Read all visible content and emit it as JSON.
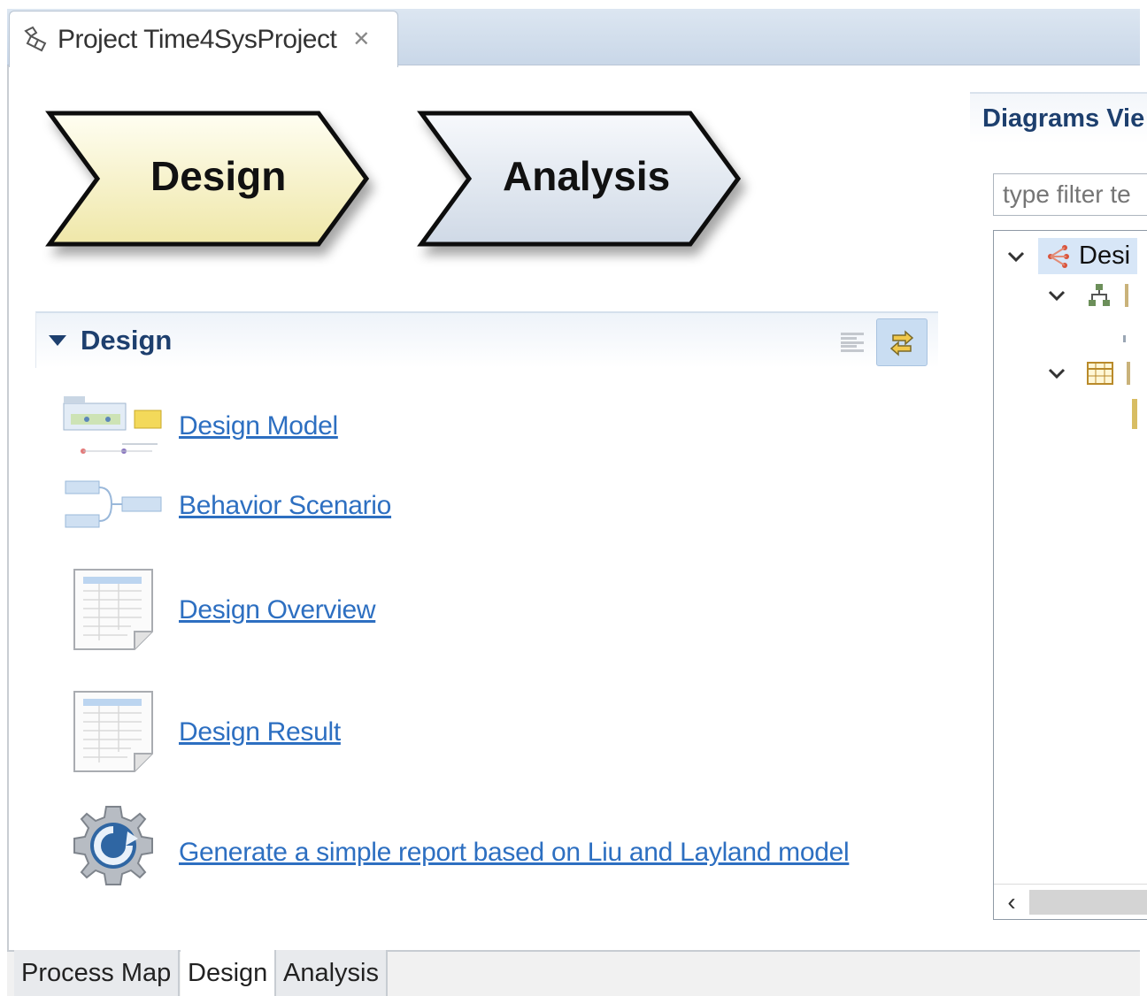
{
  "editor": {
    "tab_title": "Project Time4SysProject",
    "tab_icon": "project-icon",
    "close_icon": "close-icon"
  },
  "process_map": {
    "steps": [
      {
        "label": "Design",
        "fill": "#f7f2c6"
      },
      {
        "label": "Analysis",
        "fill": "#dde4ee"
      }
    ]
  },
  "section": {
    "title": "Design",
    "tools": [
      "collapse-lines-icon",
      "link-with-editor-icon"
    ],
    "items": [
      {
        "label": "Design Model",
        "icon": "design-model-icon"
      },
      {
        "label": "Behavior Scenario",
        "icon": "behavior-scenario-icon"
      },
      {
        "label": "Design Overview",
        "icon": "table-sheet-icon"
      },
      {
        "label": "Design Result",
        "icon": "table-sheet-icon"
      },
      {
        "label": "Generate a simple report based on Liu and Layland model",
        "icon": "gear-refresh-icon"
      }
    ]
  },
  "diagrams_view": {
    "title": "Diagrams Vie",
    "filter_placeholder": "type filter te",
    "tree_root_label": "Desi"
  },
  "bottom_tabs": [
    {
      "label": "Process Map",
      "active": false
    },
    {
      "label": "Design",
      "active": true
    },
    {
      "label": "Analysis",
      "active": false
    }
  ],
  "colors": {
    "link": "#2d6fc1",
    "header_text": "#1d3f6e",
    "tab_bar": "#c9d7e8"
  }
}
